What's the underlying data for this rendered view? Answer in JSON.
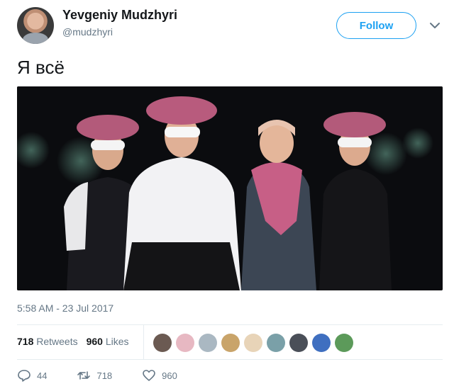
{
  "author": {
    "name": "Yevgeniy Mudzhyri",
    "handle": "@mudzhyri"
  },
  "follow_label": "Follow",
  "tweet": {
    "text": "Я всё",
    "timestamp": "5:58 AM - 23 Jul 2017"
  },
  "stats": {
    "retweets_count": "718",
    "retweets_label": "Retweets",
    "likes_count": "960",
    "likes_label": "Likes"
  },
  "actions": {
    "reply_count": "44",
    "retweet_count": "718",
    "like_count": "960"
  },
  "colors": {
    "accent": "#1da1f2",
    "muted": "#657786",
    "text": "#14171a",
    "border": "#e6ecf0"
  },
  "icons": [
    "chevron-down-icon",
    "reply-icon",
    "retweet-icon",
    "heart-icon"
  ]
}
